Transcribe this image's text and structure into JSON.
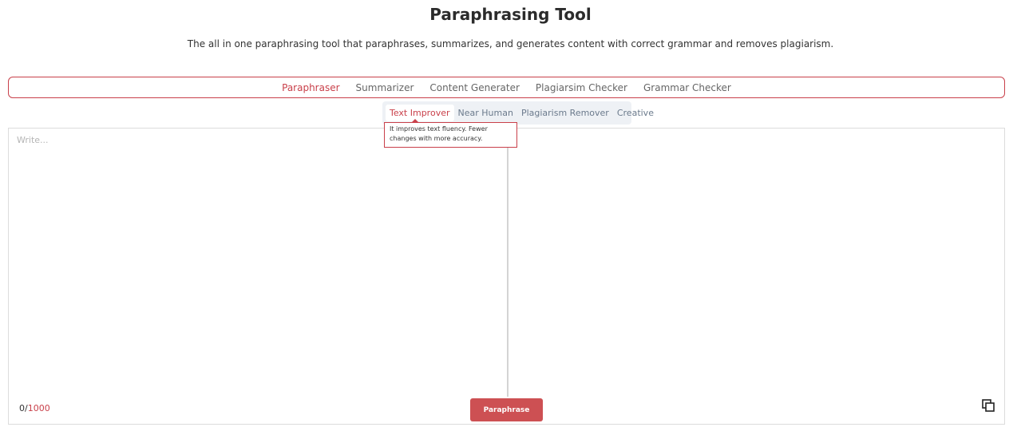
{
  "header": {
    "title": "Paraphrasing Tool",
    "subtitle": "The all in one paraphrasing tool that paraphrases, summarizes, and generates content with correct grammar and removes plagiarism."
  },
  "tool_tabs": [
    {
      "label": "Paraphraser",
      "active": true
    },
    {
      "label": "Summarizer",
      "active": false
    },
    {
      "label": "Content Generater",
      "active": false
    },
    {
      "label": "Plagiarsim Checker",
      "active": false
    },
    {
      "label": "Grammar Checker",
      "active": false
    }
  ],
  "mode_tabs": [
    {
      "label": "Text Improver",
      "active": true
    },
    {
      "label": "Near Human",
      "active": false
    },
    {
      "label": "Plagiarism Remover",
      "active": false
    },
    {
      "label": "Creative",
      "active": false
    }
  ],
  "tooltip": {
    "text": "It improves text fluency. Fewer changes with more accuracy."
  },
  "editor": {
    "placeholder": "Write...",
    "value": "",
    "count": "0",
    "separator": "/",
    "max": "1000"
  },
  "actions": {
    "paraphrase_label": "Paraphrase",
    "copy_icon": "copy-icon"
  },
  "colors": {
    "accent": "#c9404a",
    "button": "#cd5053",
    "mode_bg": "#eef1f5"
  }
}
